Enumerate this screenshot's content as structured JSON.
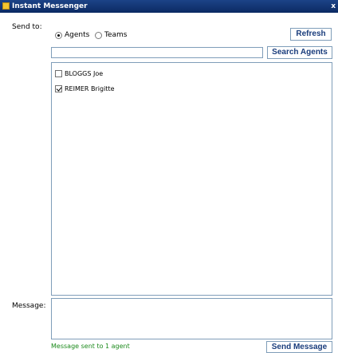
{
  "window": {
    "title": "Instant Messenger",
    "close_glyph": "x"
  },
  "send_to": {
    "label": "Send to:",
    "options": [
      {
        "label": "Agents",
        "selected": true
      },
      {
        "label": "Teams",
        "selected": false
      }
    ]
  },
  "buttons": {
    "refresh": "Refresh",
    "search_agents": "Search Agents",
    "send_message": "Send Message"
  },
  "search": {
    "value": "",
    "placeholder": ""
  },
  "agents": [
    {
      "name": "BLOGGS Joe",
      "checked": false
    },
    {
      "name": "REIMER Brigitte",
      "checked": true
    }
  ],
  "message": {
    "label": "Message:",
    "value": ""
  },
  "status": {
    "text": "Message sent to 1 agent",
    "color": "#1c8a1c"
  },
  "colors": {
    "titlebar": "#0b2a63",
    "button_text": "#1a3d7c",
    "border": "#7f9db9"
  },
  "icons": {
    "window_icon": "app-icon"
  }
}
